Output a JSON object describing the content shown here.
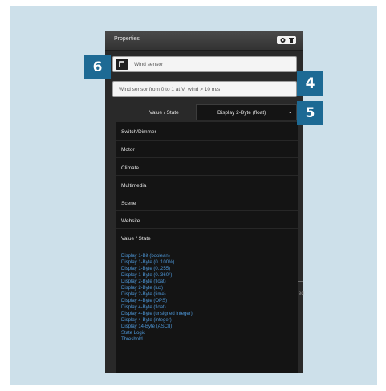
{
  "panel": {
    "title": "Properties",
    "controls": {
      "settings_icon": "gear-icon",
      "trash_icon": "trash-icon"
    },
    "name_field": {
      "icon": "sensor-icon",
      "value": "Wind sensor"
    },
    "description_field": {
      "value": "Wind sensor from 0 to 1 at V_wind > 10 m/s"
    },
    "type_label": "Value / State",
    "type_select": {
      "value": "Display 2-Byte (float)",
      "caret": "⌄"
    }
  },
  "dropdown": {
    "categories": [
      "Switch/Dimmer",
      "Motor",
      "Climate",
      "Multimedia",
      "Scene",
      "Website",
      "Value / State"
    ],
    "value_state_options": [
      "Display 1-Bit (boolean)",
      "Display 1-Byte (0..100%)",
      "Display 1-Byte (0..255)",
      "Display 1-Byte (0..360°)",
      "Display 2-Byte (float)",
      "Display 2-Byte (lux)",
      "Display 2-Byte (time)",
      "Display 4-Byte (OPS)",
      "Display 4-Byte (float)",
      "Display 4-Byte (unsigned integer)",
      "Display 4-Byte (integer)",
      "Display 14-Byte (ASCII)",
      "State Logic",
      "Threshold"
    ]
  },
  "side_fragment": "ed",
  "callouts": {
    "c6": "6",
    "c4": "4",
    "c5": "5"
  },
  "colors": {
    "callout": "#1d6a94",
    "link": "#4d96d6",
    "frame": "#cde0ea",
    "panel": "#292929"
  }
}
